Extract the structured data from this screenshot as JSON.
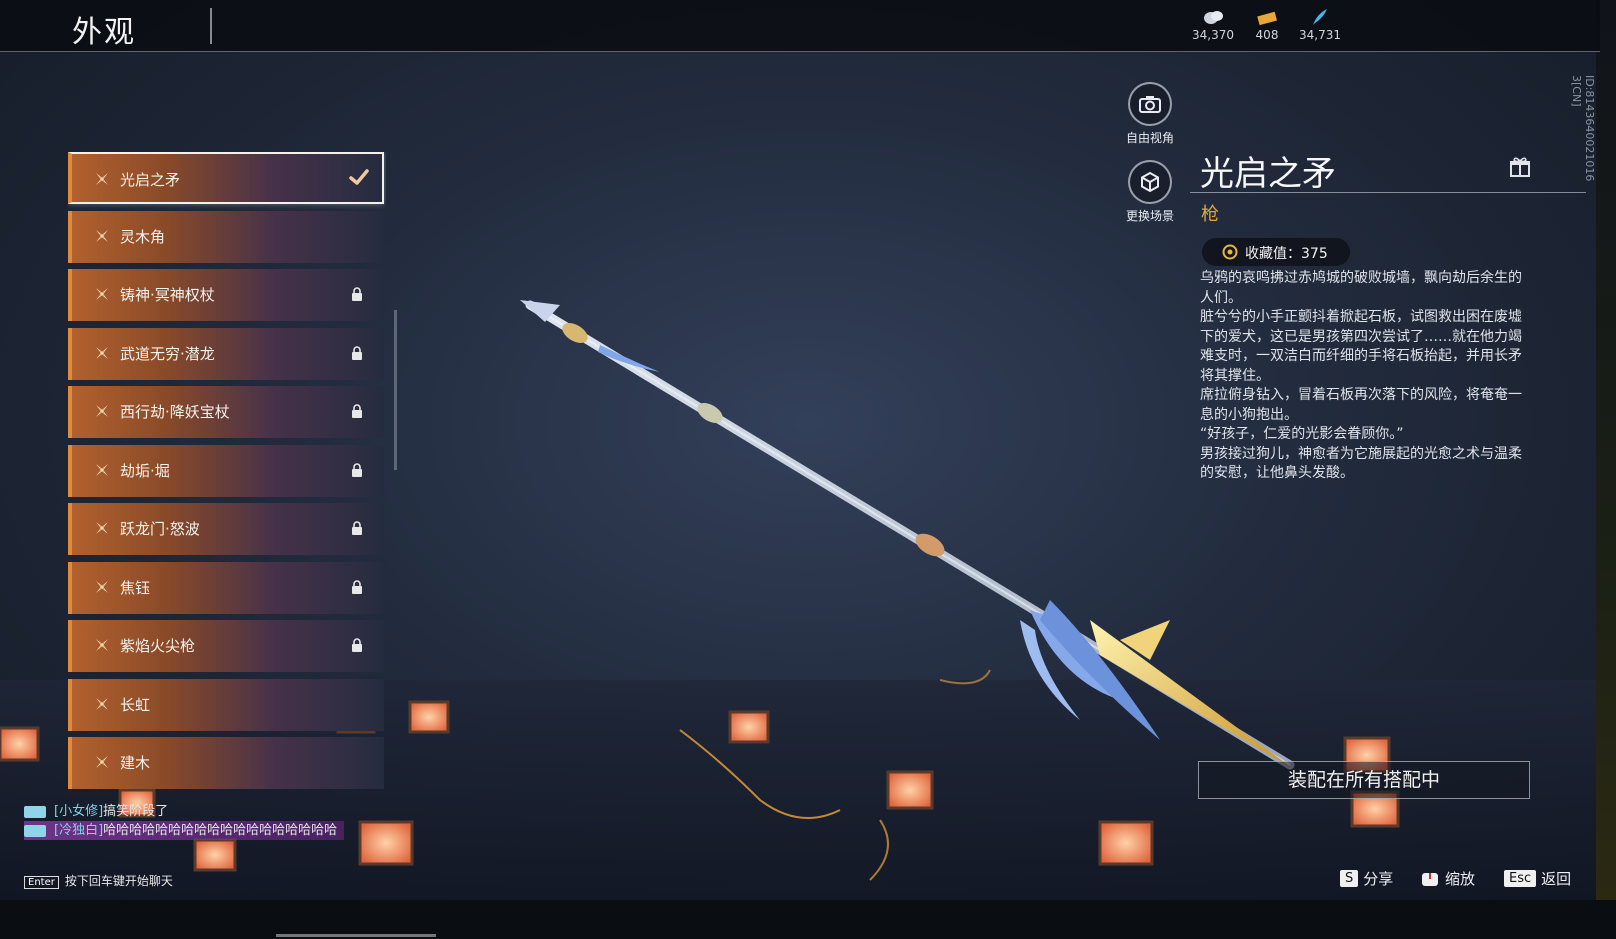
{
  "header": {
    "title": "外观",
    "currencies": [
      {
        "icon": "coin-bag-icon",
        "value": "34,370"
      },
      {
        "icon": "ticket-icon",
        "value": "408"
      },
      {
        "icon": "feather-icon",
        "value": "34,731"
      }
    ],
    "id_label": "ID:8143640021016 3[CN]"
  },
  "skin_list": {
    "items": [
      {
        "label": "光启之矛",
        "state": "selected"
      },
      {
        "label": "灵木角",
        "state": "unlocked"
      },
      {
        "label": "铸神·冥神权杖",
        "state": "locked"
      },
      {
        "label": "武道无穷·潜龙",
        "state": "locked"
      },
      {
        "label": "西行劫·降妖宝杖",
        "state": "locked"
      },
      {
        "label": "劫垢·堀",
        "state": "locked"
      },
      {
        "label": "跃龙门·怒波",
        "state": "locked"
      },
      {
        "label": "焦钰",
        "state": "locked"
      },
      {
        "label": "紫焰火尖枪",
        "state": "locked"
      },
      {
        "label": "长虹",
        "state": "unlocked"
      },
      {
        "label": "建木",
        "state": "unlocked"
      }
    ]
  },
  "tools": {
    "free_view": "自由视角",
    "change_scene": "更换场景"
  },
  "detail": {
    "name": "光启之矛",
    "type": "枪",
    "collection": "收藏值：375",
    "description": [
      "乌鸦的哀鸣拂过赤鸠城的破败城墙，飘向劫后余生的人们。",
      "脏兮兮的小手正颤抖着掀起石板，试图救出困在废墟下的爱犬，这已是男孩第四次尝试了……就在他力竭难支时，一双洁白而纤细的手将石板抬起，并用长矛将其撑住。",
      "席拉俯身钻入，冒着石板再次落下的风险，将奄奄一息的小狗抱出。",
      "“好孩子，仁爱的光影会眷顾你。”",
      "男孩接过狗儿，神愈者为它施展起的光愈之术与温柔的安慰，让他鼻头发酸。"
    ],
    "equip_button": "装配在所有搭配中"
  },
  "hints": {
    "share_key": "S",
    "share": "分享",
    "zoom": "缩放",
    "back_key": "Esc",
    "back": "返回"
  },
  "chat": {
    "line1_name": "[小女修]",
    "line1_text": "搞笑阶段了",
    "line2_name": "[冷独白]",
    "line2_text": "哈哈哈哈哈哈哈哈哈哈哈哈哈哈哈哈哈哈",
    "enter_key": "Enter",
    "prompt": "按下回车键开始聊天"
  },
  "colors": {
    "accent_orange": "#e08a3c",
    "type_gold": "#e0a93e",
    "chat_name": "#7fd3e6"
  }
}
